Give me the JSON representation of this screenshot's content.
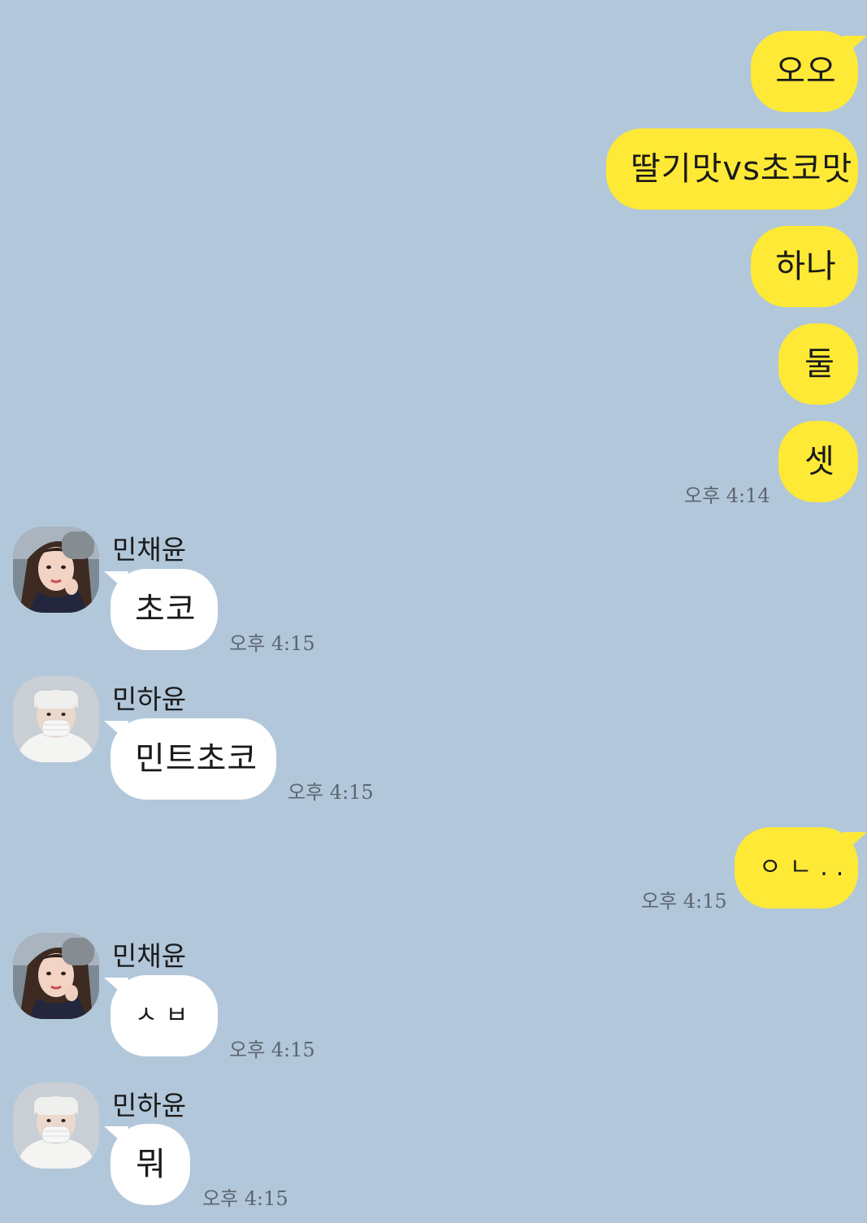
{
  "colors": {
    "background": "#b2c7da",
    "my_bubble": "#fee936",
    "their_bubble": "#ffffff"
  },
  "messages": {
    "me1": "오오",
    "me2": "딸기맛vs초코맛",
    "me3": "하나",
    "me4": "둘",
    "me5": "셋",
    "me5_time": "오후 4:14",
    "r1_name": "민채윤",
    "r1_text": "초코",
    "r1_time": "오후 4:15",
    "r2_name": "민하윤",
    "r2_text": "민트초코",
    "r2_time": "오후 4:15",
    "me6": "ㅇㄴ..",
    "me6_time": "오후 4:15",
    "r3_name": "민채윤",
    "r3_text": "ㅅㅂ",
    "r3_time": "오후 4:15",
    "r4_name": "민하윤",
    "r4_text": "뭐",
    "r4_time": "오후 4:15"
  },
  "avatars": {
    "chaeyun": "profile-photo-woman-beanie",
    "hayun": "profile-photo-person-mask-white-beanie"
  }
}
